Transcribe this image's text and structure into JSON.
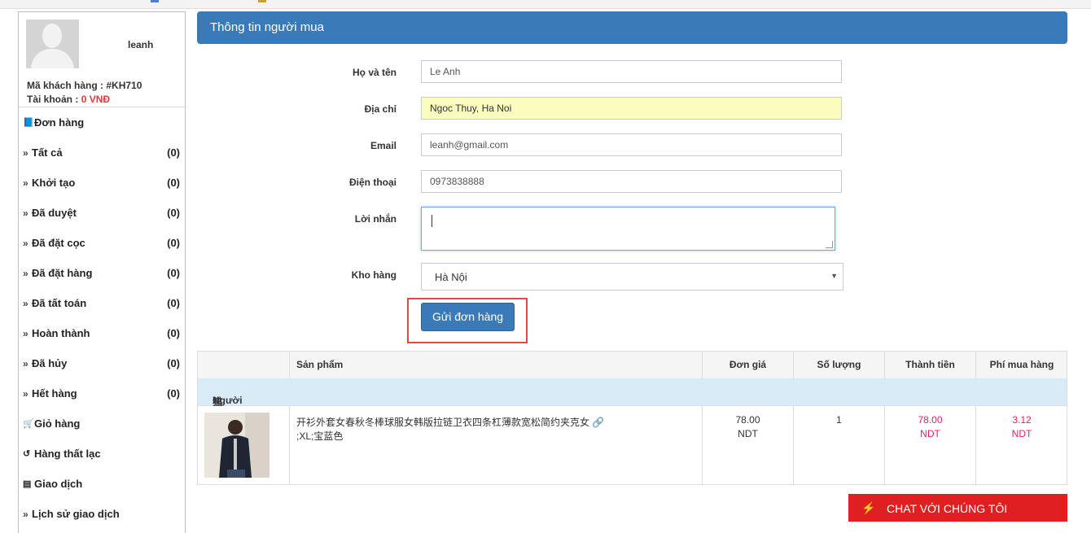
{
  "user": {
    "username": "leanh",
    "customer_code_label": "Mã khách hàng : ",
    "customer_code": "#KH710",
    "balance_label": "Tài khoản : ",
    "balance": "0 VNĐ"
  },
  "sidebar": {
    "orders_heading": "Đơn hàng",
    "items": [
      {
        "label": "Tất cả",
        "count": "(0)"
      },
      {
        "label": "Khởi tạo",
        "count": "(0)"
      },
      {
        "label": "Đã duyệt",
        "count": "(0)"
      },
      {
        "label": "Đã đặt cọc",
        "count": "(0)"
      },
      {
        "label": "Đã đặt hàng",
        "count": "(0)"
      },
      {
        "label": "Đã tất toán",
        "count": "(0)"
      },
      {
        "label": "Hoàn thành",
        "count": "(0)"
      },
      {
        "label": "Đã hủy",
        "count": "(0)"
      },
      {
        "label": "Hết hàng",
        "count": "(0)"
      }
    ],
    "cart": "Giỏ hàng",
    "lost_goods": "Hàng thất lạc",
    "transactions": "Giao dịch",
    "transaction_history": "Lịch sử giao dịch"
  },
  "panel": {
    "title": "Thông tin người mua"
  },
  "form": {
    "name_label": "Họ và tên",
    "name_value": "Le Anh",
    "address_label": "Địa chỉ",
    "address_value": "Ngoc Thuy, Ha Noi",
    "email_label": "Email",
    "email_value": "leanh@gmail.com",
    "phone_label": "Điện thoại",
    "phone_value": "0973838888",
    "message_label": "Lời nhắn",
    "message_value": "",
    "warehouse_label": "Kho hàng",
    "warehouse_value": "Hà Nội",
    "submit_label": "Gửi đơn hàng"
  },
  "table": {
    "headers": {
      "product": "Sản phẩm",
      "unit_price": "Đơn giá",
      "quantity": "Số lượng",
      "total": "Thành tiền",
      "fee": "Phí mua hàng"
    },
    "seller_label": "Người bán : ",
    "seller_name": "猫咪旗舰店",
    "rows": [
      {
        "name": "开衫外套女春秋冬棒球服女韩版拉链卫衣四条杠薄款宽松简约夹克女",
        "variant": ";XL;宝蓝色",
        "unit_price": "78.00",
        "unit_price_currency": "NDT",
        "quantity": "1",
        "total": "78.00",
        "total_currency": "NDT",
        "fee": "3.12",
        "fee_currency": "NDT"
      }
    ]
  },
  "chat": {
    "label": "CHAT VỚI CHÚNG TÔI"
  },
  "colors": {
    "primary": "#3a7ab8",
    "danger": "#e02020",
    "highlight": "#e91e63"
  },
  "icons": {
    "orders": "book-icon",
    "cart": "cart-icon",
    "lost": "history-icon",
    "transactions": "money-icon",
    "link": "link-icon",
    "chat": "bolt-icon"
  }
}
